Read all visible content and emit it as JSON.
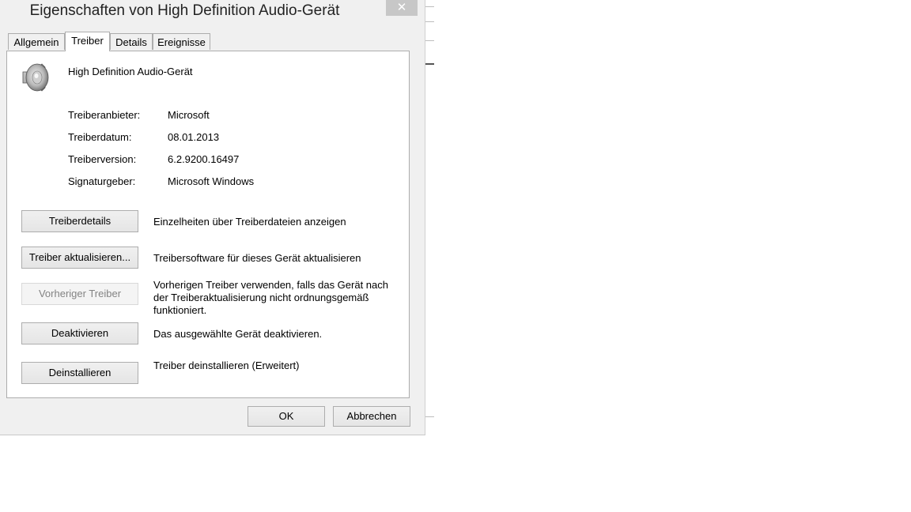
{
  "window": {
    "title": "Eigenschaften von High Definition Audio-Gerät",
    "close_glyph": "✕"
  },
  "tabs": [
    {
      "label": "Allgemein",
      "active": false
    },
    {
      "label": "Treiber",
      "active": true
    },
    {
      "label": "Details",
      "active": false
    },
    {
      "label": "Ereignisse",
      "active": false
    }
  ],
  "device": {
    "name": "High Definition Audio-Gerät",
    "icon": "speaker-icon"
  },
  "driver_info": [
    {
      "label": "Treiberanbieter:",
      "value": "Microsoft"
    },
    {
      "label": "Treiberdatum:",
      "value": "08.01.2013"
    },
    {
      "label": "Treiberversion:",
      "value": "6.2.9200.16497"
    },
    {
      "label": "Signaturgeber:",
      "value": "Microsoft Windows"
    }
  ],
  "actions": [
    {
      "button": "Treiberdetails",
      "description": "Einzelheiten über Treiberdateien anzeigen",
      "enabled": true
    },
    {
      "button": "Treiber aktualisieren...",
      "description": "Treibersoftware für dieses Gerät aktualisieren",
      "enabled": true
    },
    {
      "button": "Vorheriger Treiber",
      "description": "Vorherigen Treiber verwenden, falls das Gerät nach der Treiberaktualisierung nicht ordnungsgemäß funktioniert.",
      "enabled": false
    },
    {
      "button": "Deaktivieren",
      "description": "Das ausgewählte Gerät deaktivieren.",
      "enabled": true
    },
    {
      "button": "Deinstallieren",
      "description": "Treiber deinstallieren (Erweitert)",
      "enabled": true
    }
  ],
  "footer": {
    "ok_label": "OK",
    "cancel_label": "Abbrechen"
  },
  "colors": {
    "dialog_background": "#f0f0f0",
    "panel_background": "#ffffff",
    "border": "#adadad",
    "close_button": "#c7c7c7",
    "disabled_text": "#838383"
  }
}
